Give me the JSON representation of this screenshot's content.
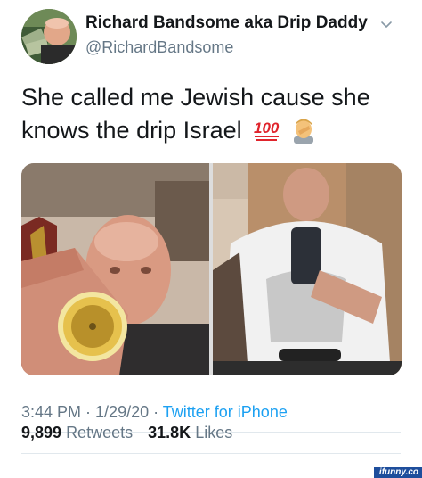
{
  "author": {
    "display_name": "Richard Bandsome aka Drip Daddy",
    "handle": "@RichardBandsome"
  },
  "tweet": {
    "text": "She called me Jewish cause she knows the drip Israel",
    "emoji": [
      "hundred-points-emoji",
      "man-facepalming-emoji"
    ]
  },
  "media": {
    "images": [
      "selfie-with-gold-watch",
      "mirror-selfie-with-phone"
    ]
  },
  "meta": {
    "time": "3:44 PM",
    "date": "1/29/20",
    "separator": " · ",
    "source": "Twitter for iPhone"
  },
  "stats": {
    "retweets_count": "9,899",
    "retweets_label": "Retweets",
    "likes_count": "31.8K",
    "likes_label": "Likes"
  },
  "watermark": "ifunny.co",
  "colors": {
    "text": "#14171a",
    "secondary": "#657786",
    "link": "#1da1f2",
    "divider": "#e1e8ed"
  }
}
